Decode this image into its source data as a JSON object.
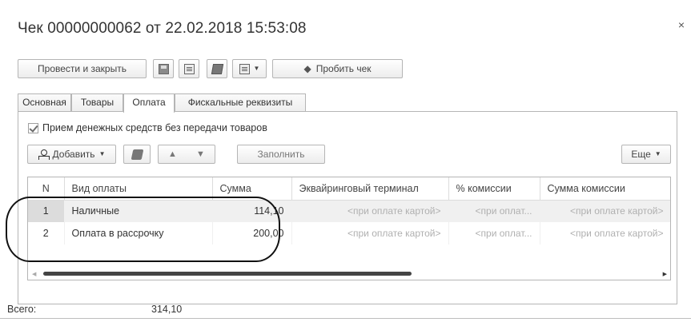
{
  "window": {
    "title": "Чек 00000000062 от 22.02.2018 15:53:08",
    "close_icon": "close-icon"
  },
  "toolbar": {
    "post_and_close": "Провести и закрыть",
    "save_icon": "save-disk-icon",
    "post_icon": "post-document-icon",
    "edit_icon": "edit-pencil-icon",
    "print_icon": "print-list-icon",
    "punch_receipt": "Пробить чек",
    "punch_icon": "cash-register-icon"
  },
  "tabs": [
    {
      "label": "Основная"
    },
    {
      "label": "Товары"
    },
    {
      "label": "Оплата",
      "active": true
    },
    {
      "label": "Фискальные реквизиты"
    }
  ],
  "payment": {
    "checkbox_label": "Прием денежных средств без передачи товаров",
    "checkbox_checked": true,
    "add_button": "Добавить",
    "fill_button": "Заполнить",
    "more_button": "Еще",
    "columns": [
      "N",
      "Вид оплаты",
      "Сумма",
      "Эквайринговый терминал",
      "% комиссии",
      "Сумма комиссии"
    ],
    "rows": [
      {
        "n": "1",
        "type": "Наличные",
        "sum": "114,10",
        "terminal": "<при оплате картой>",
        "commission_pct": "<при оплат...",
        "commission_sum": "<при оплате картой>",
        "selected": true
      },
      {
        "n": "2",
        "type": "Оплата в рассрочку",
        "sum": "200,00",
        "terminal": "<при оплате картой>",
        "commission_pct": "<при оплат...",
        "commission_sum": "<при оплате картой>",
        "selected": false
      }
    ]
  },
  "footer": {
    "total_label": "Всего:",
    "total_value": "314,10"
  }
}
